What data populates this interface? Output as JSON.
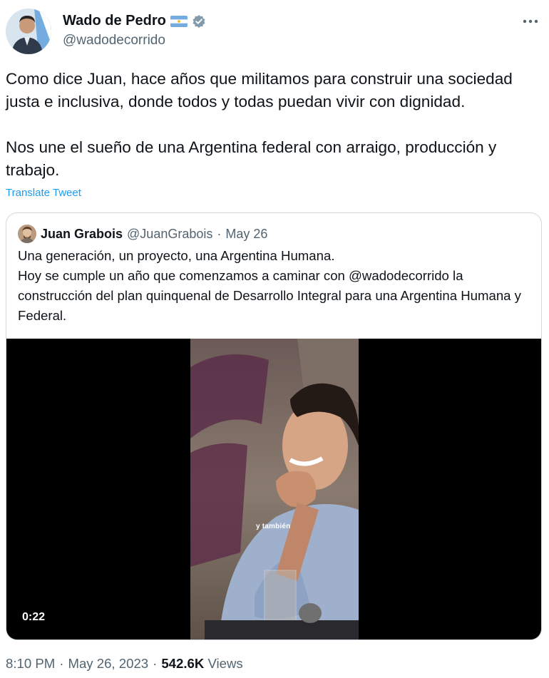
{
  "author": {
    "name": "Wado de Pedro",
    "handle": "@wadodecorrido",
    "flag_icon": "argentina-flag-icon",
    "verified_icon": "verified-badge-icon"
  },
  "more_icon": "more-horizontal-icon",
  "tweet": {
    "text": "Como dice Juan, hace años que militamos para construir una sociedad justa e inclusiva, donde todos y todas puedan vivir con dignidad.\n\nNos une el sueño de una Argentina federal con arraigo, producción y trabajo.",
    "translate_label": "Translate Tweet"
  },
  "quote": {
    "name": "Juan Grabois",
    "handle": "@JuanGrabois",
    "separator": "·",
    "date": "May 26",
    "text": "Una generación, un proyecto, una Argentina Humana.\nHoy se cumple un año que comenzamos a caminar con @wadodecorrido la construcción del plan quinquenal de Desarrollo Integral para una Argentina Humana y Federal.",
    "video": {
      "caption": "y también",
      "duration": "0:22"
    }
  },
  "footer": {
    "time": "8:10 PM",
    "sep1": "·",
    "date": "May 26, 2023",
    "sep2": "·",
    "views_count": "542.6K",
    "views_label": "Views"
  },
  "colors": {
    "text": "#0f1419",
    "secondary": "#536471",
    "link": "#1d9bf0",
    "border": "#cfd9de",
    "verified": "#829aab"
  }
}
